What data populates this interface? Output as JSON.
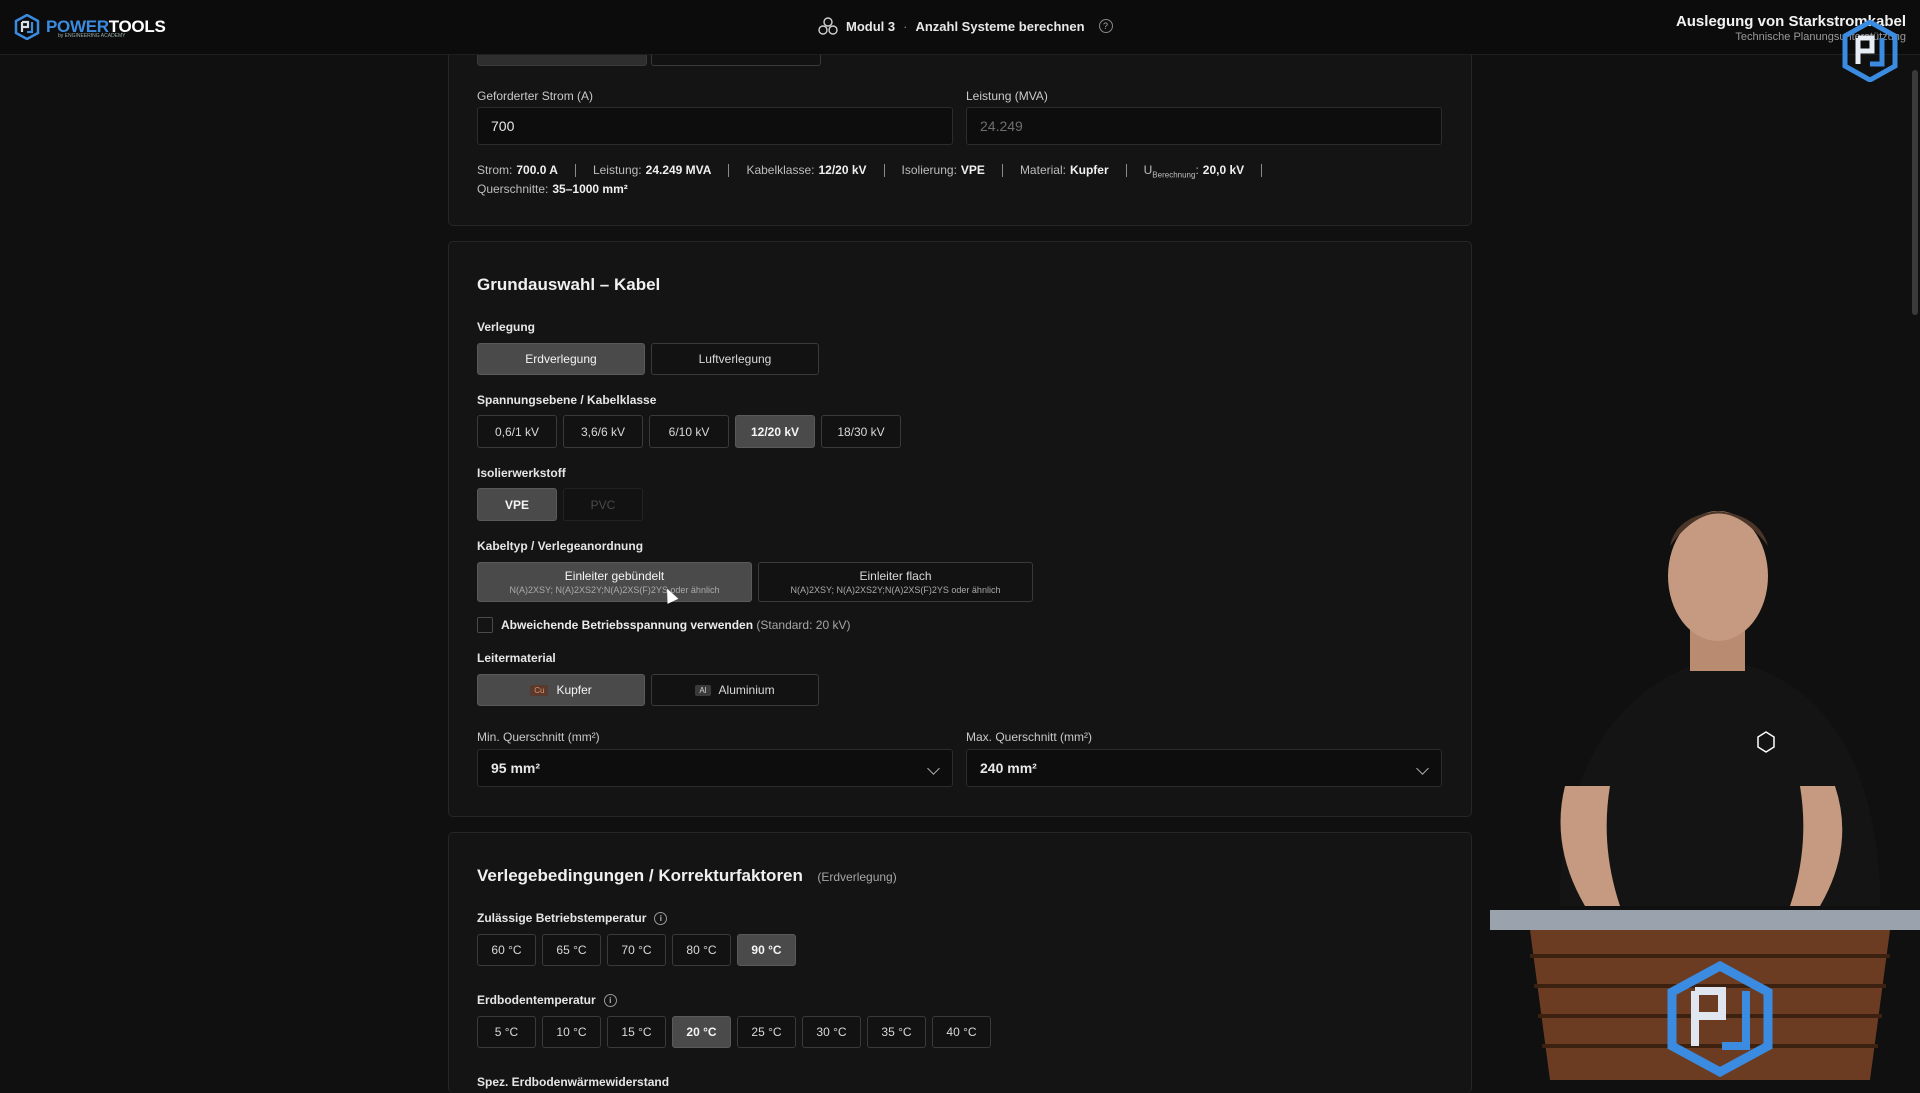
{
  "header": {
    "logo_word_power": "POWER",
    "logo_word_tools": "TOOLS",
    "logo_sub": "by ENGINEERING ACADEMY",
    "module": "Modul 3",
    "separator": "·",
    "task": "Anzahl Systeme berechnen",
    "help": "?",
    "right_title": "Auslegung von Starkstromkabel",
    "right_subtitle": "Technische Planungsunterstützung"
  },
  "inputs": {
    "strom_label": "Geforderter Strom (A)",
    "strom_value": "700",
    "leistung_label": "Leistung (MVA)",
    "leistung_value": "24.249"
  },
  "summary": {
    "strom_label": "Strom:",
    "strom_value": "700.0 A",
    "leistung_label": "Leistung:",
    "leistung_value": "24.249 MVA",
    "kabelklasse_label": "Kabelklasse:",
    "kabelklasse_value": "12/20 kV",
    "isolierung_label": "Isolierung:",
    "isolierung_value": "VPE",
    "material_label": "Material:",
    "material_value": "Kupfer",
    "u_label": "U",
    "u_sub": "Berechnung",
    "u_colon": ":",
    "u_value": "20,0 kV",
    "querschnitte_label": "Querschnitte:",
    "querschnitte_value": "35–1000 mm²"
  },
  "grundauswahl": {
    "title": "Grundauswahl – Kabel",
    "verlegung_label": "Verlegung",
    "verlegung_options": [
      "Erdverlegung",
      "Luftverlegung"
    ],
    "spannung_label": "Spannungsebene / Kabelklasse",
    "spannung_options": [
      "0,6/1 kV",
      "3,6/6 kV",
      "6/10 kV",
      "12/20 kV",
      "18/30 kV"
    ],
    "isolier_label": "Isolierwerkstoff",
    "isolier_options": [
      "VPE",
      "PVC"
    ],
    "kabeltyp_label": "Kabeltyp / Verlegeanordnung",
    "kabeltyp_options": [
      {
        "title": "Einleiter gebündelt",
        "sub": "N(A)2XSY; N(A)2XS2Y;N(A)2XS(F)2YS oder ähnlich"
      },
      {
        "title": "Einleiter flach",
        "sub": "N(A)2XSY; N(A)2XS2Y;N(A)2XS(F)2YS oder ähnlich"
      }
    ],
    "abweichend_label": "Abweichende Betriebsspannung verwenden",
    "abweichend_hint": "(Standard: 20 kV)",
    "leiter_label": "Leitermaterial",
    "leiter_options": [
      {
        "chip": "Cu",
        "label": "Kupfer"
      },
      {
        "chip": "Al",
        "label": "Aluminium"
      }
    ],
    "min_label": "Min. Querschnitt (mm²)",
    "min_value": "95 mm²",
    "max_label": "Max. Querschnitt (mm²)",
    "max_value": "240 mm²"
  },
  "verlegebedingungen": {
    "title": "Verlegebedingungen / Korrekturfaktoren",
    "title_hint": "(Erdverlegung)",
    "betrieb_label": "Zulässige Betriebstemperatur",
    "betrieb_options": [
      "60 °C",
      "65 °C",
      "70 °C",
      "80 °C",
      "90 °C"
    ],
    "erdboden_label": "Erdbodentemperatur",
    "erdboden_options": [
      "5 °C",
      "10 °C",
      "15 °C",
      "20 °C",
      "25 °C",
      "30 °C",
      "35 °C",
      "40 °C"
    ],
    "next_label": "Spez. Erdbodenwärmewiderstand",
    "info": "i"
  },
  "colors": {
    "accent_blue": "#3b8be0",
    "selected_bg": "#4a4a4a",
    "copper": "#c2693b"
  }
}
